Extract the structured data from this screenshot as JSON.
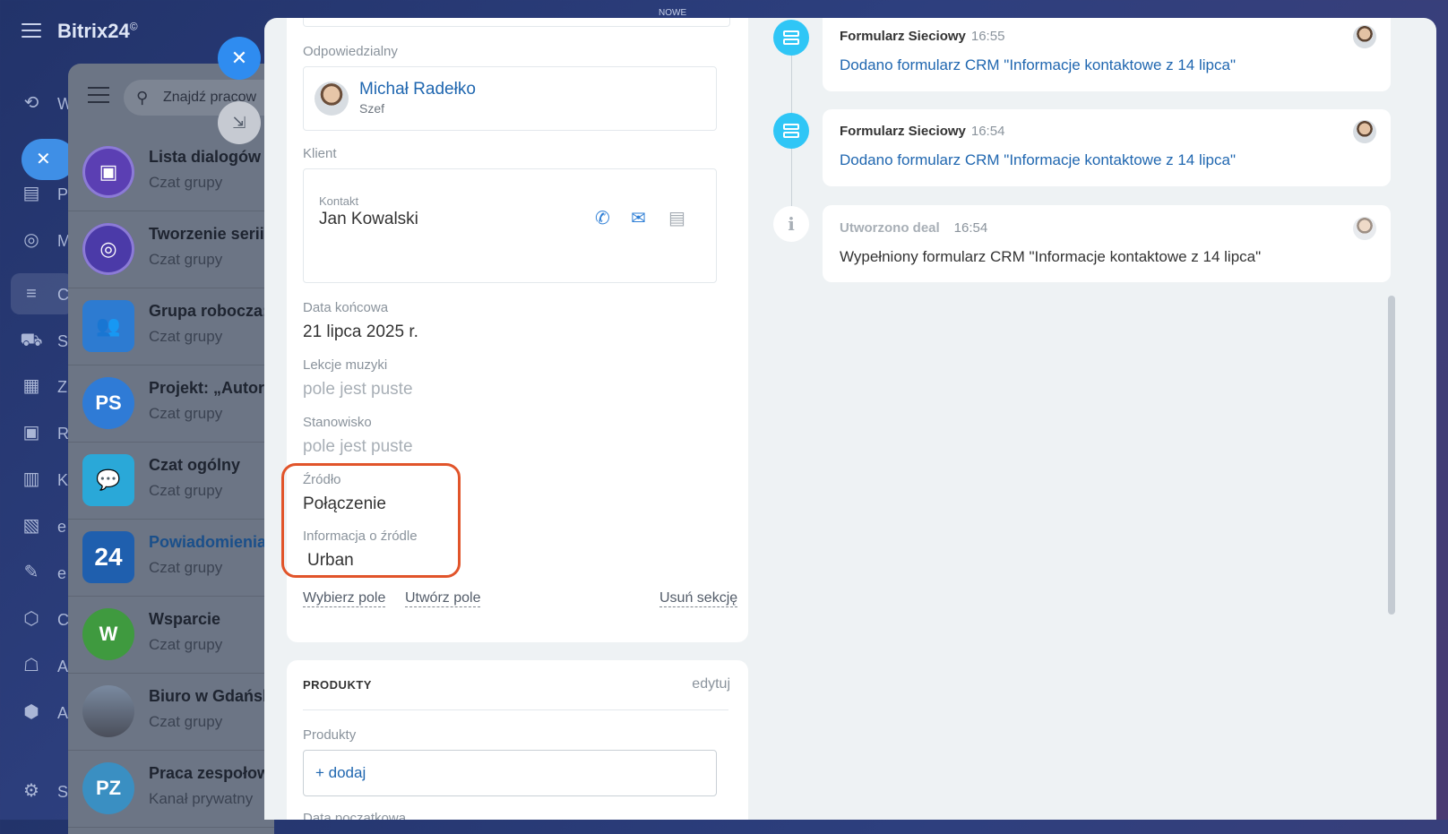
{
  "app": {
    "logo": "Bitrix24",
    "logo_mark": "©",
    "top_badge": "NOWE"
  },
  "sidebar": {
    "letters": [
      "W",
      "P",
      "M",
      "C",
      "S",
      "Z",
      "R",
      "K",
      "e",
      "e",
      "C",
      "A",
      "A",
      "S"
    ]
  },
  "chat_panel": {
    "search_placeholder": "Znajdź pracow",
    "items": [
      {
        "title": "Lista dialogów",
        "sub": "Czat grupy",
        "avatar_text": "",
        "color": "#5b3fb3"
      },
      {
        "title": "Tworzenie serii",
        "sub": "Czat grupy",
        "avatar_text": "",
        "color": "#4b3aa8"
      },
      {
        "title": "Grupa robocza:",
        "sub": "Czat grupy",
        "avatar_text": "",
        "color": "#2d7bd1"
      },
      {
        "title": "Projekt: „Autor",
        "sub": "Czat grupy",
        "avatar_text": "PS",
        "color": "#2f7bd6"
      },
      {
        "title": "Czat ogólny",
        "sub": "Czat grupy",
        "avatar_text": "",
        "color": "#2aa8d8"
      },
      {
        "title": "Powiadomienia",
        "sub": "Czat grupy",
        "avatar_text": "24",
        "color": "#1f5fae"
      },
      {
        "title": "Wsparcie",
        "sub": "Czat grupy",
        "avatar_text": "W",
        "color": "#3f9a3f"
      },
      {
        "title": "Biuro w Gdańsk",
        "sub": "Czat grupy",
        "avatar_text": "",
        "color": "#5a5f6e"
      },
      {
        "title": "Praca zespołow",
        "sub": "Kanał prywatny",
        "avatar_text": "PZ",
        "color": "#3a8fc2"
      }
    ]
  },
  "deal": {
    "responsible": {
      "label": "Odpowiedzialny",
      "name": "Michał Radełko",
      "role": "Szef"
    },
    "client": {
      "label": "Klient",
      "contact_label": "Kontakt",
      "contact_name": "Jan Kowalski"
    },
    "end_date": {
      "label": "Data końcowa",
      "value": "21 lipca 2025 r."
    },
    "music_lessons": {
      "label": "Lekcje muzyki",
      "value": "pole jest puste"
    },
    "position": {
      "label": "Stanowisko",
      "value": "pole jest puste"
    },
    "source": {
      "label": "Źródło",
      "value": "Połączenie"
    },
    "source_info": {
      "label": "Informacja o źródle",
      "value": "Urban"
    },
    "actions": {
      "select_field": "Wybierz pole",
      "create_field": "Utwórz pole",
      "delete_section": "Usuń sekcję"
    },
    "products": {
      "section_title": "PRODUKTY",
      "edit": "edytuj",
      "label": "Produkty",
      "add": "+ dodaj",
      "start_date_label": "Data początkowa"
    }
  },
  "timeline": [
    {
      "title": "Formularz Sieciowy",
      "time": "16:55",
      "text": "Dodano formularz CRM \"Informacje kontaktowe z 14 lipca\"",
      "kind": "form"
    },
    {
      "title": "Formularz Sieciowy",
      "time": "16:54",
      "text": "Dodano formularz CRM \"Informacje kontaktowe z 14 lipca\"",
      "kind": "form"
    },
    {
      "title": "Utworzono deal",
      "time": "16:54",
      "text": "Wypełniony formularz CRM \"Informacje kontaktowe z 14 lipca\"",
      "kind": "info"
    }
  ]
}
